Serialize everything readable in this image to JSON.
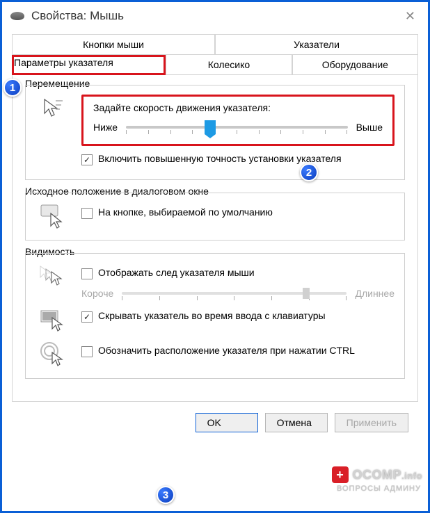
{
  "window": {
    "title": "Свойства: Мышь"
  },
  "tabs": {
    "row1": [
      {
        "label": "Кнопки мыши"
      },
      {
        "label": "Указатели"
      }
    ],
    "row2": [
      {
        "label": "Параметры указателя",
        "active": true
      },
      {
        "label": "Колесико"
      },
      {
        "label": "Оборудование"
      }
    ]
  },
  "groups": {
    "movement": {
      "title": "Перемещение",
      "speed_label": "Задайте скорость движения указателя:",
      "slow": "Ниже",
      "fast": "Выше",
      "precision_checkbox": "Включить повышенную точность установки указателя"
    },
    "snap": {
      "title": "Исходное положение в диалоговом окне",
      "checkbox": "На кнопке, выбираемой по умолчанию"
    },
    "visibility": {
      "title": "Видимость",
      "trail_checkbox": "Отображать след указателя мыши",
      "trail_short": "Короче",
      "trail_long": "Длиннее",
      "hide_checkbox": "Скрывать указатель во время ввода с клавиатуры",
      "ctrl_checkbox": "Обозначить расположение указателя при нажатии CTRL"
    }
  },
  "buttons": {
    "ok": "OK",
    "cancel": "Отмена",
    "apply": "Применить"
  },
  "callouts": {
    "one": "1",
    "two": "2",
    "three": "3"
  },
  "watermark": {
    "brand": "OCOMP",
    "tld": ".info",
    "sub": "ВОПРОСЫ АДМИНУ"
  }
}
